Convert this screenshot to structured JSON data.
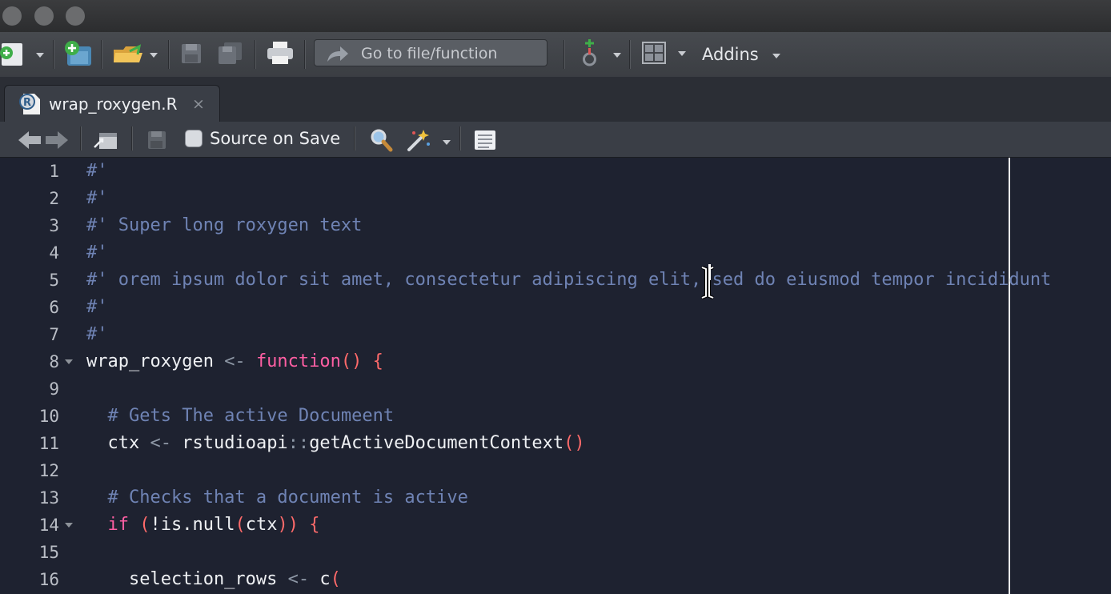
{
  "toolbar": {
    "goto_placeholder": "Go to file/function",
    "addins_label": "Addins"
  },
  "tab": {
    "filename": "wrap_roxygen.R",
    "close_glyph": "×",
    "file_type_badge": "R"
  },
  "editor_toolbar": {
    "source_on_save_label": "Source on Save",
    "source_on_save_checked": false
  },
  "icons": [
    "new-file-icon",
    "new-project-icon",
    "open-file-icon",
    "save-icon",
    "save-all-icon",
    "print-icon",
    "goto-arrow-icon",
    "vcs-icon",
    "pane-layout-icon",
    "back-arrow-icon",
    "forward-arrow-icon",
    "show-in-window-icon",
    "search-icon",
    "magic-wand-icon",
    "compile-report-icon",
    "fold-caret-icon",
    "text-cursor-icon"
  ],
  "code": {
    "lines": [
      {
        "n": "1",
        "fold": false,
        "tokens": [
          {
            "t": "#'",
            "c": "cmt"
          }
        ]
      },
      {
        "n": "2",
        "fold": false,
        "tokens": [
          {
            "t": "#'",
            "c": "cmt"
          }
        ]
      },
      {
        "n": "3",
        "fold": false,
        "tokens": [
          {
            "t": "#' Super long roxygen text",
            "c": "cmt"
          }
        ]
      },
      {
        "n": "4",
        "fold": false,
        "tokens": [
          {
            "t": "#'",
            "c": "cmt"
          }
        ]
      },
      {
        "n": "5",
        "fold": false,
        "tokens": [
          {
            "t": "#' orem ipsum dolor sit amet, consectetur adipiscing elit, sed do eiusmod tempor incididunt",
            "c": "cmt"
          }
        ]
      },
      {
        "n": "6",
        "fold": false,
        "tokens": [
          {
            "t": "#'",
            "c": "cmt"
          }
        ]
      },
      {
        "n": "7",
        "fold": false,
        "tokens": [
          {
            "t": "#'",
            "c": "cmt"
          }
        ]
      },
      {
        "n": "8",
        "fold": true,
        "tokens": [
          {
            "t": "wrap_roxygen ",
            "c": "plain"
          },
          {
            "t": "<-",
            "c": "op"
          },
          {
            "t": " ",
            "c": "plain"
          },
          {
            "t": "function",
            "c": "kw"
          },
          {
            "t": "()",
            "c": "paren"
          },
          {
            "t": " ",
            "c": "plain"
          },
          {
            "t": "{",
            "c": "paren"
          }
        ]
      },
      {
        "n": "9",
        "fold": false,
        "tokens": []
      },
      {
        "n": "10",
        "fold": false,
        "tokens": [
          {
            "t": "  # Gets The active Documeent",
            "c": "cmt"
          }
        ]
      },
      {
        "n": "11",
        "fold": false,
        "tokens": [
          {
            "t": "  ctx ",
            "c": "plain"
          },
          {
            "t": "<-",
            "c": "op"
          },
          {
            "t": " rstudioapi",
            "c": "plain"
          },
          {
            "t": "::",
            "c": "op"
          },
          {
            "t": "getActiveDocumentContext",
            "c": "plain"
          },
          {
            "t": "()",
            "c": "paren"
          }
        ]
      },
      {
        "n": "12",
        "fold": false,
        "tokens": []
      },
      {
        "n": "13",
        "fold": false,
        "tokens": [
          {
            "t": "  # Checks that a document is active",
            "c": "cmt"
          }
        ]
      },
      {
        "n": "14",
        "fold": true,
        "tokens": [
          {
            "t": "  ",
            "c": "plain"
          },
          {
            "t": "if",
            "c": "kw"
          },
          {
            "t": " ",
            "c": "plain"
          },
          {
            "t": "(",
            "c": "paren"
          },
          {
            "t": "!is.null",
            "c": "plain"
          },
          {
            "t": "(",
            "c": "paren"
          },
          {
            "t": "ctx",
            "c": "plain"
          },
          {
            "t": "))",
            "c": "paren"
          },
          {
            "t": " ",
            "c": "plain"
          },
          {
            "t": "{",
            "c": "paren"
          }
        ]
      },
      {
        "n": "15",
        "fold": false,
        "tokens": []
      },
      {
        "n": "16",
        "fold": false,
        "tokens": [
          {
            "t": "    selection_rows ",
            "c": "plain"
          },
          {
            "t": "<-",
            "c": "op"
          },
          {
            "t": " c",
            "c": "plain"
          },
          {
            "t": "(",
            "c": "paren"
          }
        ]
      }
    ]
  },
  "colors": {
    "editor_bg": "#1e2230",
    "comment": "#6f83b4",
    "keyword": "#ff5fa3",
    "operator": "#8e98a6",
    "paren": "#ff6a6a",
    "text": "#eef0f3",
    "margin_line": "#f0f0f0"
  }
}
